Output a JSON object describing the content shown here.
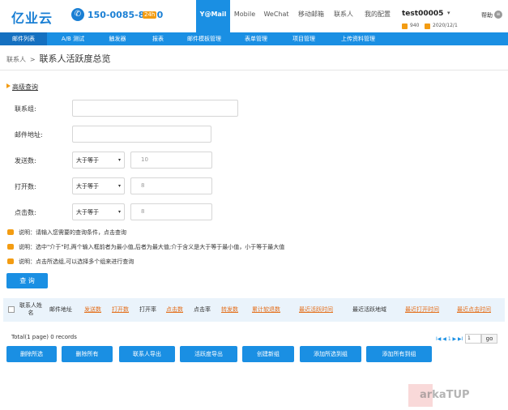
{
  "header": {
    "logo": "亿业云",
    "phone_icon": "phone-icon",
    "phone": "150-0085-8090",
    "phone_badge": "24h",
    "nav": [
      {
        "label": "Y@Mail",
        "active": true
      },
      {
        "label": "Mobile"
      },
      {
        "label": "WeChat"
      },
      {
        "label": "移动邮箱"
      },
      {
        "label": "联系人"
      },
      {
        "label": "我的配置"
      }
    ],
    "user": "test00005",
    "user_caret": "▾",
    "points": "940",
    "date": "2020/12/1",
    "help": "帮助",
    "help_icon": "help-icon",
    "accent": "#1a8fe3",
    "orange": "#f39c12"
  },
  "menubar": [
    "邮件列表",
    "A/B 测试",
    "触发器",
    "报表",
    "邮件模板管理",
    "表单管理",
    "项目管理",
    "上传资料管理"
  ],
  "breadcrumb": {
    "parent": "联系人",
    "separator": ">",
    "current": "联系人活跃度总览"
  },
  "search": {
    "title": "高级查询",
    "fields": {
      "group_label": "联系组:",
      "email_label": "邮件地址:",
      "sent_label": "发送数:",
      "sent_op": "大于等于",
      "sent_value": "10",
      "open_label": "打开数:",
      "open_op": "大于等于",
      "open_value": "8",
      "click_label": "点击数:",
      "click_op": "大于等于",
      "click_value": "8"
    },
    "caret": "▾",
    "notes": [
      "说明：请输入您需要的查询条件，点击查询",
      "说明：选中\"介于\"时,两个输入框前者为最小值,后者为最大值;介于含义是大于等于最小值，小于等于最大值",
      "说明：点击所选组,可以选择多个组来进行查询"
    ],
    "query_button": "查 询"
  },
  "table": {
    "columns": [
      {
        "label": "联系人姓名",
        "link": false
      },
      {
        "label": "邮件地址",
        "link": false
      },
      {
        "label": "发送数",
        "link": true
      },
      {
        "label": "打开数",
        "link": true
      },
      {
        "label": "打开率",
        "link": false
      },
      {
        "label": "点击数",
        "link": true
      },
      {
        "label": "点击率",
        "link": false
      },
      {
        "label": "转发数",
        "link": true
      },
      {
        "label": "累计软退数",
        "link": true
      },
      {
        "label": "最近活跃时间",
        "link": true
      },
      {
        "label": "最近活跃地域",
        "link": false
      },
      {
        "label": "最近打开时间",
        "link": true
      },
      {
        "label": "最近点击时间",
        "link": true
      }
    ],
    "rows": []
  },
  "pagination": {
    "total": "Total(1 page) 0 records",
    "controls": "I◀ ◀ 1 ▶ ▶I",
    "page": "1",
    "go": "go"
  },
  "actions": [
    "删除所选",
    "删除所有",
    "联系人导出",
    "活跃度导出",
    "创建新组",
    "添加所选到组",
    "添加所有到组"
  ],
  "watermark": "arkaTUP"
}
